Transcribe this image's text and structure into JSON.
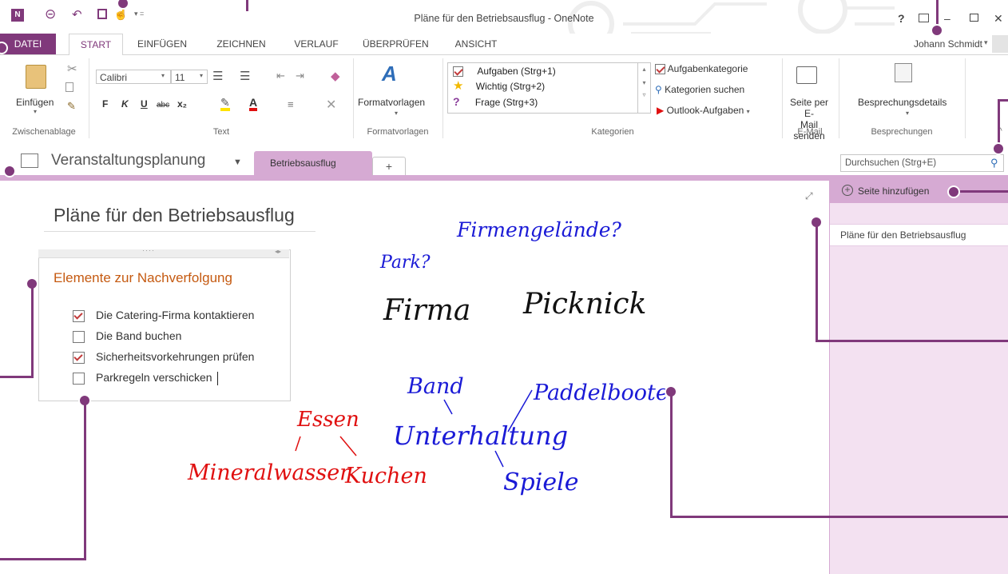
{
  "app": {
    "window_title": "Pläne für den Betriebsausflug - OneNote",
    "user": "Johann Schmidt"
  },
  "tabs": [
    "DATEI",
    "START",
    "EINFÜGEN",
    "ZEICHNEN",
    "VERLAUF",
    "ÜBERPRÜFEN",
    "ANSICHT"
  ],
  "ribbon": {
    "clipboard": {
      "paste_label": "Einfügen",
      "group_label": "Zwischenablage"
    },
    "text": {
      "font": "Calibri",
      "size": "11",
      "bold": "F",
      "italic": "K",
      "underline": "U",
      "strike": "abc",
      "subscript": "x₂",
      "group_label": "Text"
    },
    "styles": {
      "label": "Formatvorlagen",
      "group_label": "Formatvorlagen"
    },
    "tags": {
      "items": [
        "Aufgaben (Strg+1)",
        "Wichtig (Strg+2)",
        "Frage (Strg+3)"
      ],
      "task_category": "Aufgabenkategorie",
      "search_categories": "Kategorien suchen",
      "outlook_tasks": "Outlook-Aufgaben",
      "group_label": "Kategorien"
    },
    "email": {
      "label_line1": "Seite per E-",
      "label_line2": "Mail senden",
      "group_label": "E-Mail"
    },
    "meetings": {
      "label": "Besprechungsdetails",
      "group_label": "Besprechungen"
    }
  },
  "notebook": {
    "name": "Veranstaltungsplanung",
    "section": "Betriebsausflug",
    "add_section": "+",
    "search_placeholder": "Durchsuchen (Strg+E)"
  },
  "page": {
    "title": "Pläne für den Betriebsausflug",
    "note_heading": "Elemente zur Nachverfolgung",
    "todos": [
      {
        "text": "Die Catering-Firma kontaktieren",
        "checked": true
      },
      {
        "text": "Die Band buchen",
        "checked": false
      },
      {
        "text": "Sicherheitsvorkehrungen prüfen",
        "checked": true
      },
      {
        "text": "Parkregeln verschicken",
        "checked": false
      }
    ],
    "handwriting": {
      "firmengelaende": "Firmengelände?",
      "park": "Park?",
      "firma": "Firma",
      "picknick": "Picknick",
      "band": "Band",
      "paddelboote": "Paddelboote",
      "unterhaltung": "Unterhaltung",
      "spiele": "Spiele",
      "essen": "Essen",
      "mineralwasser": "Mineralwasser",
      "kuchen": "Kuchen"
    }
  },
  "pages_pane": {
    "add_page": "Seite hinzufügen",
    "pages": [
      "Pläne für den Betriebsausflug"
    ]
  },
  "colors": {
    "accent": "#80397b",
    "section": "#d6aad3",
    "ink_black": "#111111",
    "ink_blue": "#1a1ad6",
    "ink_red": "#e01010",
    "heading_orange": "#c55a11"
  }
}
